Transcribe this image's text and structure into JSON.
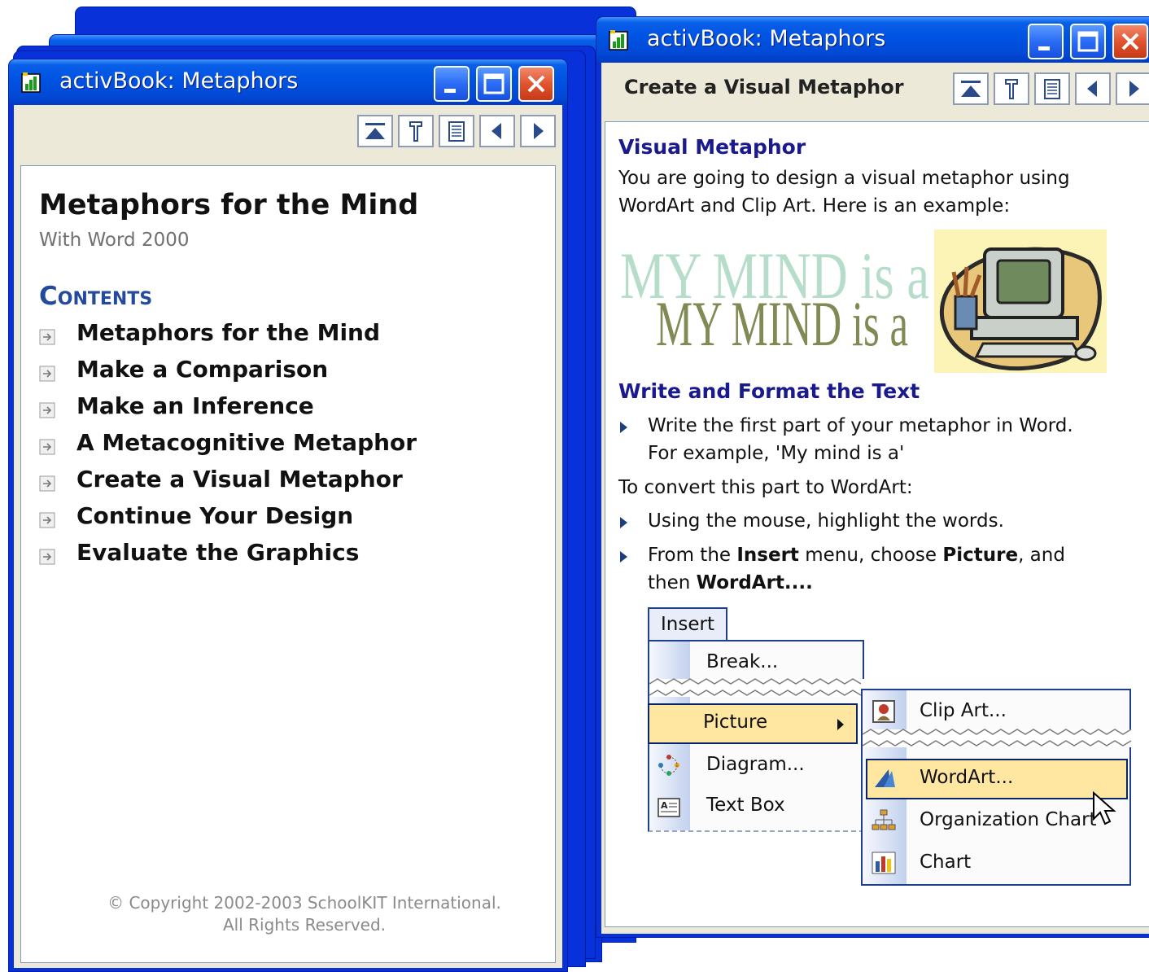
{
  "left_window": {
    "title": "activBook: Metaphors",
    "book_title": "Metaphors for the Mind",
    "book_subtitle": "With Word 2000",
    "contents_heading": "Contents",
    "toc": [
      "Metaphors for the Mind",
      "Make a Comparison",
      "Make an Inference",
      "A Metacognitive Metaphor",
      "Create a Visual Metaphor",
      "Continue Your Design",
      "Evaluate the Graphics"
    ],
    "copyright_line1": "© Copyright 2002-2003 SchoolKIT International.",
    "copyright_line2": "All Rights Reserved."
  },
  "right_window": {
    "title": "activBook: Metaphors",
    "page_title": "Create a Visual Metaphor",
    "section1_title": "Visual Metaphor",
    "intro_line1": "You are going to design a visual metaphor using",
    "intro_line2": "WordArt and Clip Art. Here is an example:",
    "wordart_text": "MY MIND is a",
    "section2_title": "Write and Format the Text",
    "step1_line1": "Write the first part of your metaphor in Word.",
    "step1_line2": "For example, 'My mind is a'",
    "convert_text": "To convert this part to WordArt:",
    "step2": "Using the mouse, highlight the words.",
    "step3_a": "From the ",
    "step3_b": "Insert",
    "step3_c": " menu, choose ",
    "step3_d": "Picture",
    "step3_e": ", and",
    "step3_f": "then ",
    "step3_g": "WordArt....",
    "menu": {
      "insert_label": "Insert",
      "break_label": "Break...",
      "picture_label": "Picture",
      "diagram_label": "Diagram...",
      "textbox_label": "Text Box",
      "clipart_label": "Clip Art...",
      "wordart_label": "WordArt...",
      "orgchart_label": "Organization Chart",
      "chart_label": "Chart"
    }
  },
  "icons": {
    "toolbar": [
      "home-icon",
      "tools-icon",
      "contents-icon",
      "back-icon",
      "forward-icon"
    ],
    "window_controls": [
      "minimize-icon",
      "maximize-icon",
      "close-icon"
    ],
    "toc_item": "expand-arrow-icon",
    "bullet": "triangle-bullet-icon"
  },
  "colors": {
    "titlebar": "#0054e3",
    "window_frame": "#0831d9",
    "close_button": "#e2532f",
    "heading_blue": "#1a1a8e",
    "contents_blue": "#234a9c",
    "menu_highlight": "#ffe7a2"
  }
}
